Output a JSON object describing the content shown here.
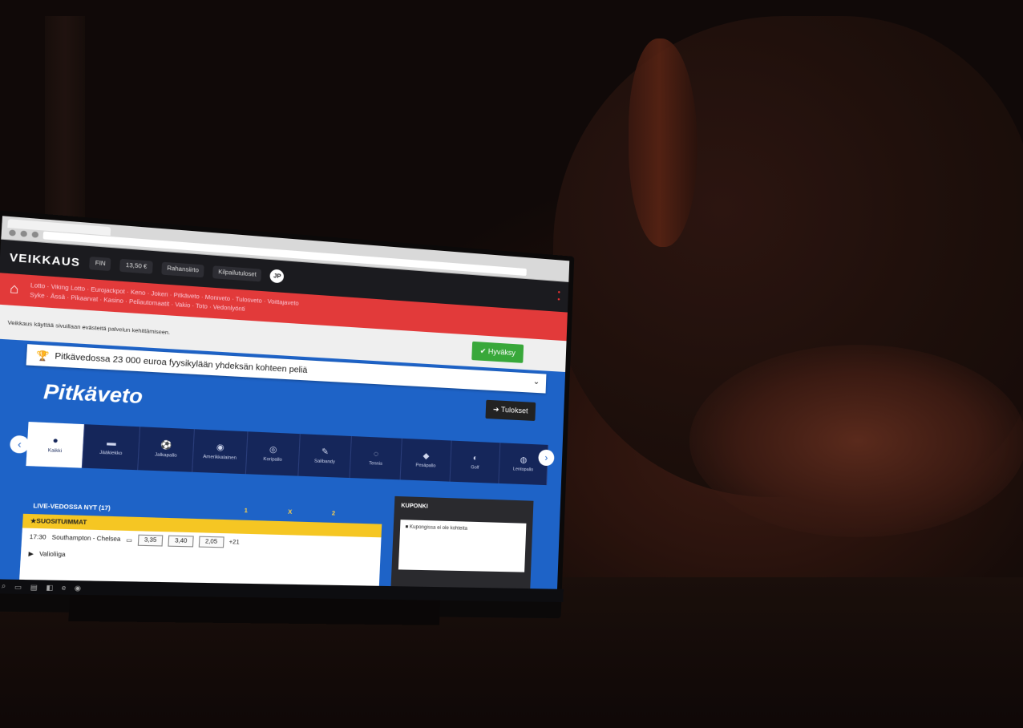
{
  "browser": {
    "tab_title": "",
    "address": ""
  },
  "site": {
    "logo": "VEIKKAUS",
    "account_pill": "FIN",
    "balance": "13,50 €",
    "deposit_label": "Rahansiirto",
    "lottery_label": "Kilpailutuloset",
    "user_initials": "JP"
  },
  "nav": {
    "links_line1": "Lotto · Viking Lotto · Eurojackpot · Keno · Jokeri · Pitkäveto · Moniveto · Tulosveto · Voittajaveto",
    "links_line2": "Syke · Ässä · Pikaarvat · Kasino · Peliautomaatit · Vakio · Toto · Vedonlyönti"
  },
  "info": {
    "text": "Veikkaus käyttää sivuillaan evästeitä palvelun kehittämiseen.",
    "accept_button": "Hyväksy"
  },
  "promo": {
    "text": "Pitkävedossa 23 000 euroa fyysikylään yhdeksän kohteen peliä"
  },
  "page": {
    "title": "Pitkäveto",
    "results_button": "Tulokset"
  },
  "sports": [
    {
      "label": "Kaikki",
      "icon": "all-icon"
    },
    {
      "label": "Jääkiekko",
      "icon": "hockey-icon"
    },
    {
      "label": "Jalkapallo",
      "icon": "football-icon"
    },
    {
      "label": "Amerikkalainen",
      "icon": "helmet-icon"
    },
    {
      "label": "Koripallo",
      "icon": "basketball-icon"
    },
    {
      "label": "Salibandy",
      "icon": "floorball-icon"
    },
    {
      "label": "Tennis",
      "icon": "tennis-icon"
    },
    {
      "label": "Pesäpallo",
      "icon": "pesapallo-icon"
    },
    {
      "label": "Golf",
      "icon": "golf-icon"
    },
    {
      "label": "Lentopallo",
      "icon": "volleyball-icon"
    }
  ],
  "live": {
    "header": "LIVE-VEDOSSA NYT (17)",
    "col1": "1",
    "colx": "X",
    "col2": "2",
    "group": "SUOSITUIMMAT",
    "match": {
      "time": "17:30",
      "name": "Southampton - Chelsea",
      "sub": "Valioliiga",
      "odd1": "3,35",
      "oddx": "3,40",
      "odd2": "2,05",
      "more": "+21"
    }
  },
  "coupon": {
    "title": "KUPONKI",
    "body": "Kupongissa ei ole kohteita"
  }
}
